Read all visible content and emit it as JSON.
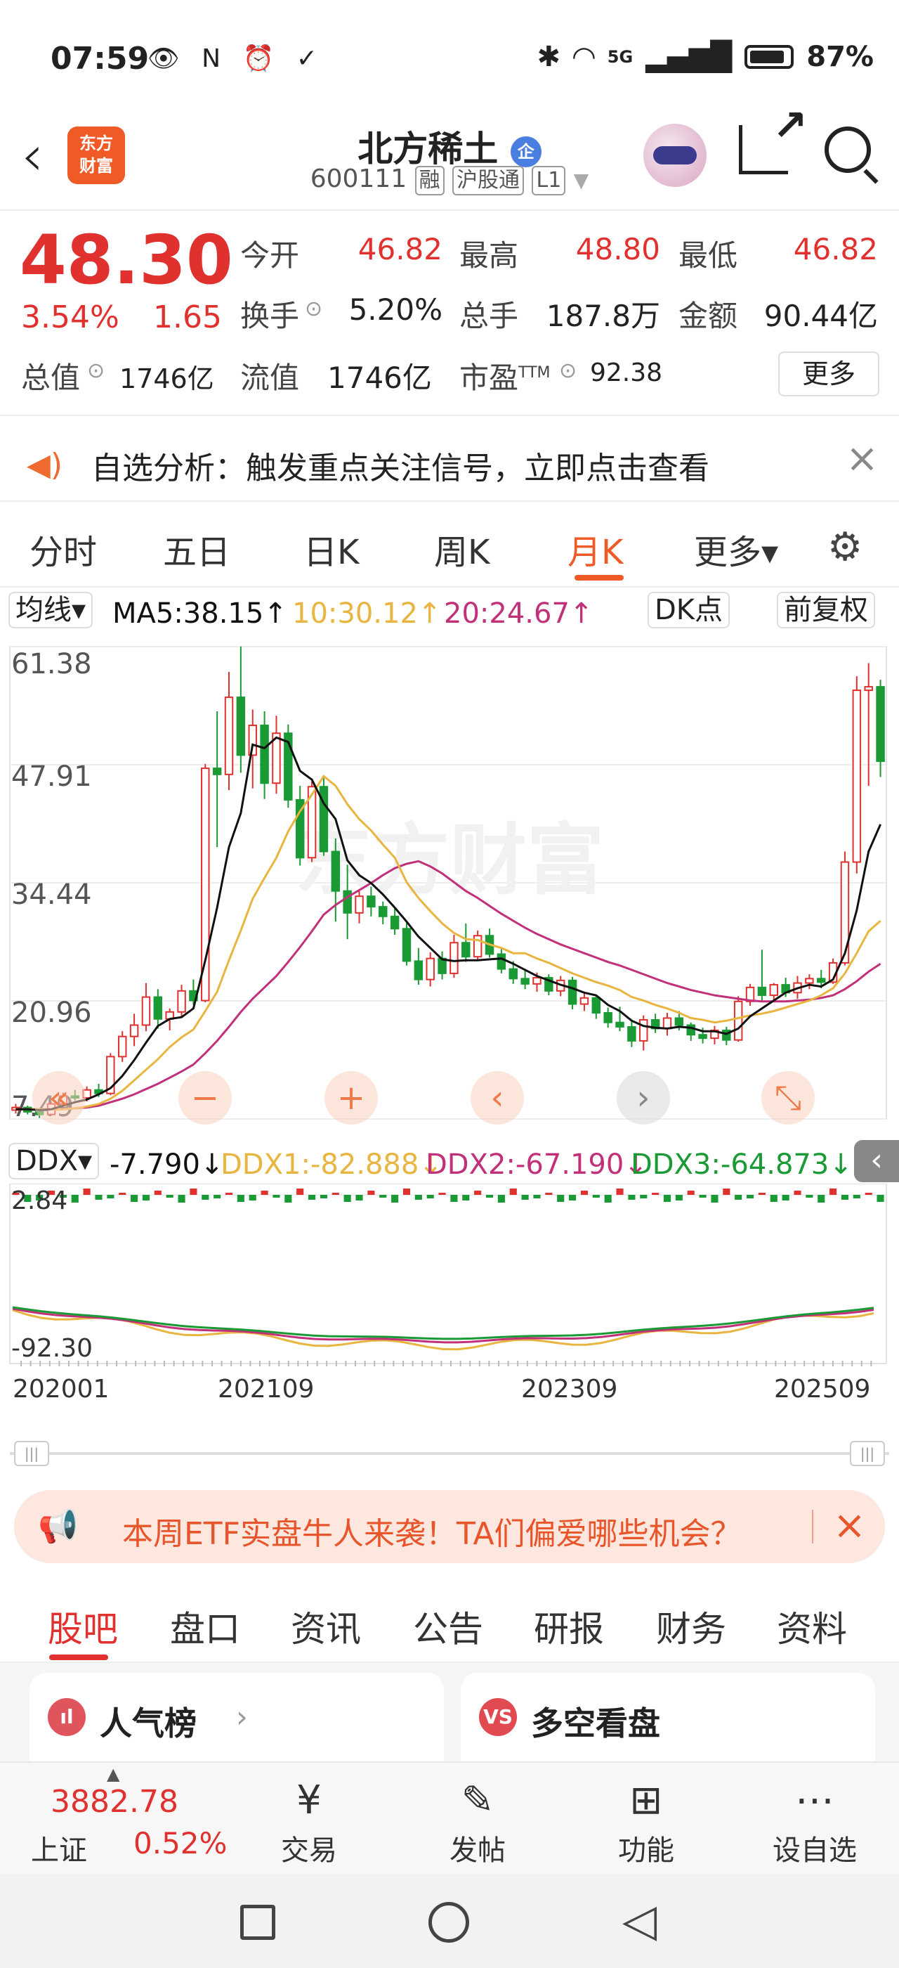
{
  "status_bar": {
    "time": "07:59",
    "battery": "87%",
    "left_icons": "👁 N ⏰ ✓",
    "signal": "5G"
  },
  "header": {
    "logo_line1": "东方",
    "logo_line2": "财富",
    "stock_name": "北方稀土",
    "enterprise_badge": "企",
    "stock_code": "600111",
    "tags": [
      "融",
      "沪股通",
      "L1"
    ]
  },
  "quote": {
    "price": "48.30",
    "change_pct": "3.54%",
    "change_amt": "1.65",
    "fields": [
      {
        "label": "今开",
        "value": "46.82"
      },
      {
        "label": "最高",
        "value": "48.80"
      },
      {
        "label": "最低",
        "value": "46.82"
      },
      {
        "label": "换手",
        "value": "5.20%"
      },
      {
        "label": "总手",
        "value": "187.8万"
      },
      {
        "label": "金额",
        "value": "90.44亿"
      },
      {
        "label": "总值",
        "value": "1746亿"
      },
      {
        "label": "流值",
        "value": "1746亿"
      },
      {
        "label": "市盈",
        "label_sup": "TTM",
        "value": "92.38"
      }
    ],
    "more_button": "更多"
  },
  "notice": {
    "text": "自选分析：触发重点关注信号，立即点击查看",
    "close": "×"
  },
  "chart_tabs": {
    "items": [
      "分时",
      "五日",
      "日K",
      "周K",
      "月K",
      "更多▾"
    ],
    "active": "月K"
  },
  "ma_row": {
    "indicator": "均线▾",
    "ma5": "MA5:38.15↑",
    "ma10": "10:30.12↑",
    "ma20": "20:24.67↑",
    "dk": "DK点",
    "fq": "前复权"
  },
  "ddx_row": {
    "indicator": "DDX▾",
    "ddx": "-7.790↓",
    "ddx1": "DDX1:-82.888↓",
    "ddx2": "DDX2:-67.190↓",
    "ddx3": "DDX3:-64.873↓"
  },
  "chart_data": {
    "type": "candlestick",
    "title": "",
    "y_ticks": [
      "61.38",
      "47.91",
      "34.44",
      "20.96",
      "7.49"
    ],
    "ylim": [
      7.49,
      61.38
    ],
    "x_ticks": [
      "202001",
      "202109",
      "202309",
      "202509"
    ],
    "candles": [
      [
        8.5,
        9.2,
        8.1,
        8.8
      ],
      [
        8.8,
        9.0,
        8.0,
        8.3
      ],
      [
        8.3,
        8.6,
        7.6,
        8.0
      ],
      [
        8.0,
        9.4,
        7.9,
        9.2
      ],
      [
        9.2,
        10.5,
        9.0,
        10.1
      ],
      [
        10.1,
        10.8,
        9.6,
        9.9
      ],
      [
        9.9,
        11.2,
        9.5,
        10.8
      ],
      [
        10.8,
        11.5,
        10.0,
        10.4
      ],
      [
        10.4,
        15.0,
        10.2,
        14.6
      ],
      [
        14.6,
        17.5,
        14.0,
        16.9
      ],
      [
        16.9,
        19.5,
        15.8,
        18.2
      ],
      [
        18.2,
        23.0,
        17.5,
        21.4
      ],
      [
        21.4,
        22.3,
        17.8,
        18.9
      ],
      [
        18.9,
        20.1,
        17.6,
        19.7
      ],
      [
        19.7,
        22.8,
        19.1,
        22.1
      ],
      [
        22.1,
        23.4,
        20.5,
        21.0
      ],
      [
        21.0,
        48.0,
        20.8,
        47.5
      ],
      [
        47.5,
        54.0,
        38.5,
        46.8
      ],
      [
        46.8,
        58.5,
        45.0,
        55.6
      ],
      [
        55.6,
        61.4,
        47.0,
        49.0
      ],
      [
        49.0,
        54.2,
        45.2,
        52.4
      ],
      [
        52.4,
        54.0,
        44.0,
        45.8
      ],
      [
        45.8,
        53.5,
        44.6,
        51.5
      ],
      [
        51.5,
        52.5,
        43.0,
        43.9
      ],
      [
        43.9,
        45.5,
        36.4,
        37.3
      ],
      [
        37.3,
        46.0,
        36.8,
        45.4
      ],
      [
        45.4,
        46.5,
        37.5,
        38.0
      ],
      [
        38.0,
        39.5,
        30.0,
        33.5
      ],
      [
        33.5,
        36.5,
        28.0,
        31.0
      ],
      [
        31.0,
        33.5,
        29.8,
        32.9
      ],
      [
        32.9,
        34.0,
        30.6,
        31.7
      ],
      [
        31.7,
        32.3,
        29.7,
        30.6
      ],
      [
        30.6,
        31.6,
        28.5,
        29.2
      ],
      [
        29.2,
        29.9,
        25.0,
        25.5
      ],
      [
        25.5,
        27.0,
        22.8,
        23.4
      ],
      [
        23.4,
        26.5,
        22.6,
        25.8
      ],
      [
        25.8,
        26.6,
        23.4,
        24.1
      ],
      [
        24.1,
        28.5,
        23.6,
        27.6
      ],
      [
        27.6,
        29.8,
        25.4,
        26.0
      ],
      [
        26.0,
        29.0,
        25.5,
        28.4
      ],
      [
        28.4,
        29.2,
        25.9,
        26.3
      ],
      [
        26.3,
        26.9,
        24.1,
        24.6
      ],
      [
        24.6,
        25.5,
        22.9,
        23.5
      ],
      [
        23.5,
        24.4,
        22.3,
        22.9
      ],
      [
        22.9,
        24.2,
        22.0,
        23.6
      ],
      [
        23.6,
        24.0,
        21.6,
        22.1
      ],
      [
        22.1,
        23.8,
        21.5,
        23.3
      ],
      [
        23.3,
        23.7,
        20.0,
        20.6
      ],
      [
        20.6,
        21.9,
        19.8,
        21.3
      ],
      [
        21.3,
        21.6,
        18.9,
        19.6
      ],
      [
        19.6,
        20.2,
        17.9,
        18.5
      ],
      [
        18.5,
        20.3,
        17.5,
        18.0
      ],
      [
        18.0,
        18.6,
        15.7,
        16.4
      ],
      [
        16.4,
        19.3,
        15.3,
        18.8
      ],
      [
        18.8,
        19.5,
        17.3,
        17.8
      ],
      [
        17.8,
        19.6,
        17.0,
        19.0
      ],
      [
        19.0,
        19.8,
        17.6,
        18.2
      ],
      [
        18.2,
        18.5,
        16.4,
        17.1
      ],
      [
        17.1,
        17.9,
        16.1,
        16.7
      ],
      [
        16.7,
        18.1,
        16.0,
        17.6
      ],
      [
        17.6,
        18.0,
        15.9,
        16.5
      ],
      [
        16.5,
        21.5,
        16.3,
        20.9
      ],
      [
        20.9,
        22.9,
        20.4,
        22.5
      ],
      [
        22.5,
        26.8,
        21.0,
        21.6
      ],
      [
        21.6,
        23.0,
        20.9,
        22.8
      ],
      [
        22.8,
        23.6,
        21.4,
        21.9
      ],
      [
        21.9,
        23.8,
        21.2,
        23.0
      ],
      [
        23.0,
        24.0,
        22.3,
        23.5
      ],
      [
        23.5,
        24.5,
        22.4,
        23.1
      ],
      [
        23.1,
        25.8,
        22.9,
        25.3
      ],
      [
        25.3,
        38.0,
        25.0,
        36.8
      ],
      [
        36.8,
        58.0,
        35.5,
        56.4
      ],
      [
        56.4,
        59.5,
        45.5,
        56.8
      ],
      [
        56.8,
        57.6,
        46.5,
        48.3
      ]
    ],
    "ma5": [
      8.6,
      8.6,
      8.5,
      8.6,
      9.0,
      9.4,
      9.7,
      10.3,
      11.0,
      12.4,
      14.2,
      16.2,
      18.1,
      18.9,
      19.1,
      20.1,
      25.6,
      31.6,
      38.5,
      42.4,
      50.2,
      49.8,
      51.0,
      50.5,
      47.2,
      46.2,
      43.5,
      41.7,
      37.0,
      35.3,
      34.4,
      33.1,
      31.6,
      30.0,
      28.3,
      27.0,
      25.7,
      25.5,
      25.6,
      25.6,
      25.7,
      25.8,
      25.2,
      24.5,
      23.8,
      23.3,
      22.8,
      22.4,
      21.9,
      21.6,
      20.5,
      19.8,
      18.7,
      18.1,
      17.9,
      17.8,
      18.0,
      17.9,
      17.5,
      17.5,
      17.2,
      17.8,
      19.2,
      20.1,
      21.0,
      21.9,
      22.4,
      22.8,
      22.6,
      23.4,
      26.4,
      31.3,
      38.0,
      41.1
    ],
    "ma10": [
      8.6,
      8.6,
      8.6,
      8.6,
      8.6,
      8.7,
      8.9,
      9.2,
      9.8,
      10.7,
      11.9,
      13.1,
      14.3,
      15.7,
      16.8,
      17.7,
      19.8,
      22.0,
      25.6,
      29.0,
      32.6,
      35.0,
      37.3,
      40.3,
      42.6,
      44.5,
      46.6,
      45.5,
      43.4,
      41.7,
      40.4,
      38.8,
      37.3,
      34.5,
      32.7,
      31.2,
      29.8,
      28.7,
      28.0,
      27.9,
      27.4,
      27.0,
      26.4,
      26.4,
      25.8,
      25.3,
      24.7,
      24.1,
      23.6,
      23.1,
      22.7,
      22.2,
      21.4,
      21.0,
      20.5,
      20.1,
      19.6,
      19.0,
      18.8,
      18.5,
      18.7,
      19.0,
      19.3,
      19.5,
      19.8,
      20.2,
      20.6,
      21.0,
      21.6,
      22.4,
      24.1,
      26.4,
      28.9,
      30.1
    ],
    "ma20": [
      8.6,
      8.6,
      8.6,
      8.6,
      8.6,
      8.7,
      8.8,
      9.0,
      9.4,
      9.8,
      10.3,
      10.9,
      11.5,
      12.2,
      12.9,
      13.7,
      15.0,
      16.4,
      18.0,
      19.7,
      21.2,
      22.5,
      23.8,
      25.4,
      27.1,
      28.9,
      30.8,
      31.9,
      32.8,
      33.6,
      34.4,
      35.3,
      36.1,
      36.6,
      36.9,
      36.3,
      35.5,
      34.5,
      33.5,
      32.7,
      31.8,
      30.9,
      30.1,
      29.3,
      28.6,
      28.0,
      27.4,
      26.9,
      26.4,
      25.9,
      25.4,
      25.0,
      24.5,
      24.0,
      23.5,
      23.0,
      22.6,
      22.2,
      21.9,
      21.6,
      21.4,
      21.2,
      21.0,
      20.9,
      20.9,
      20.9,
      21.0,
      21.1,
      21.3,
      21.6,
      22.3,
      23.2,
      24.3,
      25.2
    ]
  },
  "ddx_data": {
    "top_value": "2.84",
    "bottom_value": "-92.30"
  },
  "banner": {
    "text": "本周ETF实盘牛人来袭！TA们偏爱哪些机会？",
    "close": "×"
  },
  "sub_tabs": {
    "items": [
      "股吧",
      "盘口",
      "资讯",
      "公告",
      "研报",
      "财务",
      "资料"
    ],
    "active": "股吧"
  },
  "cards": [
    {
      "icon": "ıl",
      "title": "人气榜",
      "arrow": "›"
    },
    {
      "icon": "VS",
      "title": "多空看盘"
    }
  ],
  "bottom_nav": {
    "index_value": "3882.78",
    "index_name": "上证",
    "index_pct": "0.52%",
    "items": [
      {
        "label": "交易",
        "icon": "¥"
      },
      {
        "label": "发帖",
        "icon": "✎"
      },
      {
        "label": "功能",
        "icon": "⊞"
      },
      {
        "label": "设自选",
        "icon": "⋯"
      }
    ]
  },
  "colors": {
    "up": "#e0312f",
    "down": "#1a9a34",
    "accent": "#ef5a26",
    "ma5": "#111111",
    "ma10": "#e8b540",
    "ma20": "#c2307a"
  }
}
